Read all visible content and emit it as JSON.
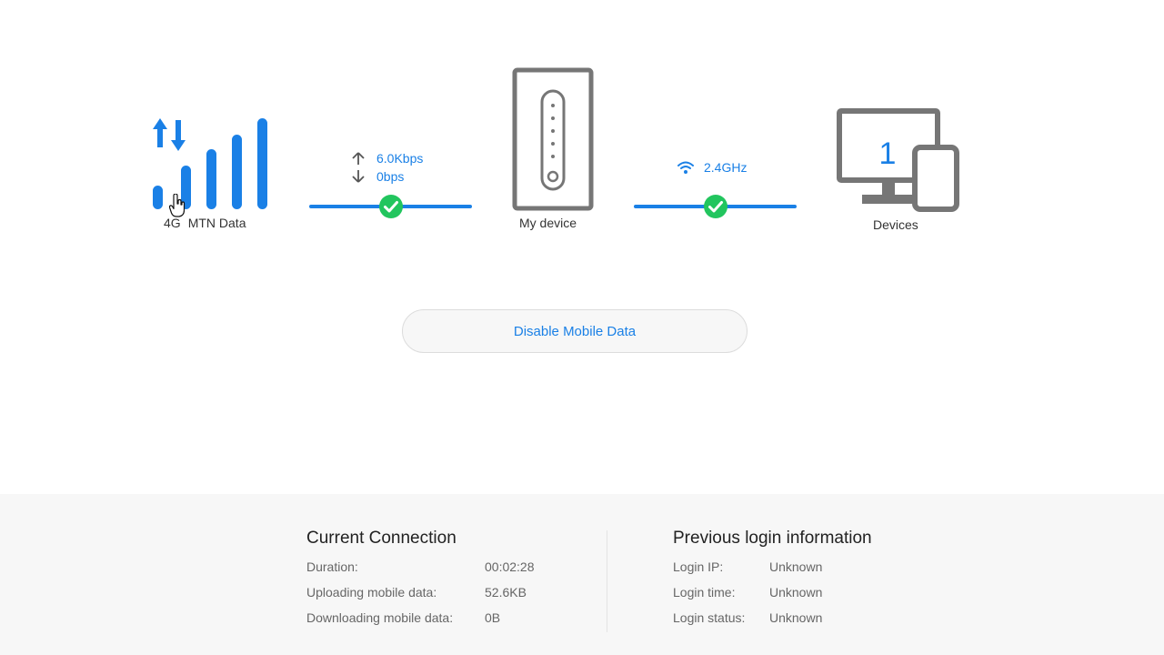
{
  "topology": {
    "network": {
      "type_label": "4G",
      "operator_label": "MTN Data",
      "icon": "signal-bars-icon"
    },
    "uplink": {
      "upload_speed": "6.0Kbps",
      "download_speed": "0bps",
      "status_icon": "check-circle-icon"
    },
    "router": {
      "label": "My device",
      "icon": "router-icon"
    },
    "wifi_link": {
      "band": "2.4GHz",
      "icon": "wifi-icon",
      "status_icon": "check-circle-icon"
    },
    "devices": {
      "count": "1",
      "label": "Devices",
      "icon": "devices-icon"
    }
  },
  "actions": {
    "toggle_mobile_data_label": "Disable Mobile Data"
  },
  "current_connection": {
    "title": "Current Connection",
    "rows": [
      {
        "label": "Duration:",
        "value": "00:02:28"
      },
      {
        "label": "Uploading mobile data:",
        "value": "52.6KB"
      },
      {
        "label": "Downloading mobile data:",
        "value": "0B"
      }
    ]
  },
  "previous_login": {
    "title": "Previous login information",
    "rows": [
      {
        "label": "Login IP:",
        "value": "Unknown"
      },
      {
        "label": "Login time:",
        "value": "Unknown"
      },
      {
        "label": "Login status:",
        "value": "Unknown"
      }
    ]
  },
  "colors": {
    "accent": "#1a80e6",
    "success": "#22c55e",
    "icon_gray": "#767676"
  }
}
